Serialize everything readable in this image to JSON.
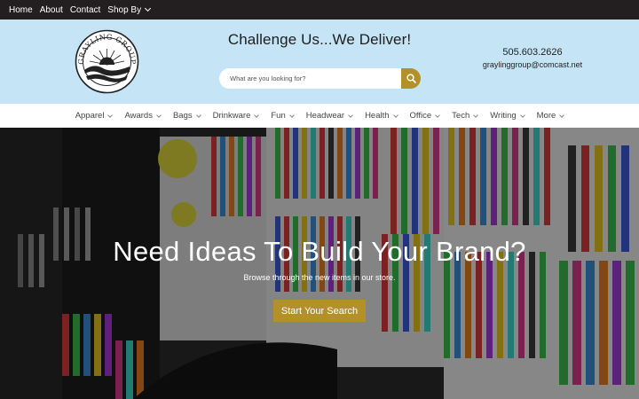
{
  "topbar": {
    "links": [
      "Home",
      "About",
      "Contact"
    ],
    "shop_by": "Shop By"
  },
  "header": {
    "logo_text": "GRAYLING GROUP",
    "tagline": "Challenge Us...We Deliver!",
    "search_placeholder": "What are you looking for?",
    "phone": "505.603.2626",
    "email": "graylinggroup@comcast.net"
  },
  "nav": {
    "items": [
      "Apparel",
      "Awards",
      "Bags",
      "Drinkware",
      "Fun",
      "Headwear",
      "Health",
      "Office",
      "Tech",
      "Writing",
      "More"
    ]
  },
  "hero": {
    "title": "Need Ideas To Build Your Brand?",
    "subtitle": "Browse through the new items in our store.",
    "button": "Start Your Search"
  },
  "colors": {
    "topbar": "#231f20",
    "header_bg": "#c5e4f6",
    "accent_gold": "#b39128"
  },
  "icons": {
    "search": "search-icon",
    "dropdown": "chevron-down-icon"
  }
}
